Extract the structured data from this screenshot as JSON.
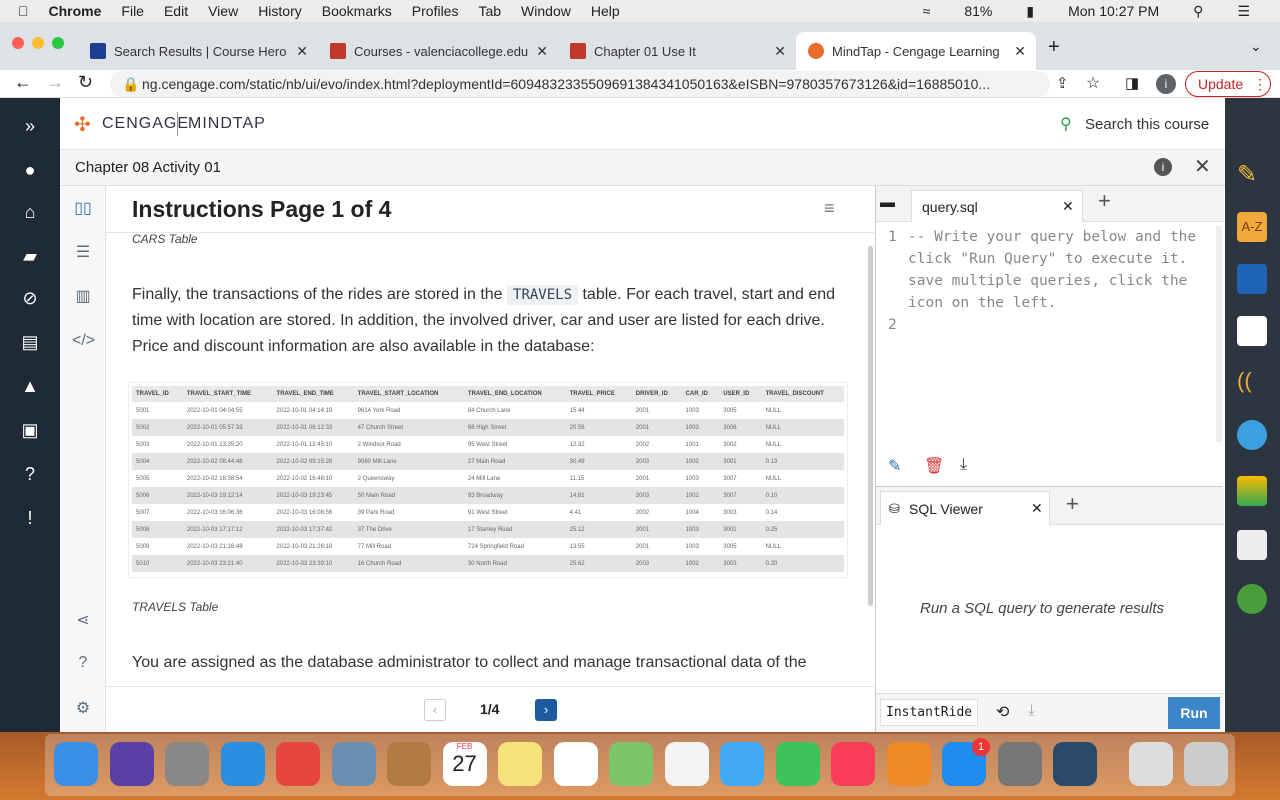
{
  "menubar": {
    "app": "Chrome",
    "items": [
      "File",
      "Edit",
      "View",
      "History",
      "Bookmarks",
      "Profiles",
      "Tab",
      "Window",
      "Help"
    ],
    "battery": "81%",
    "clock": "Mon 10:27 PM"
  },
  "tabs": [
    {
      "title": "Search Results | Course Hero",
      "color": "#1d3f91"
    },
    {
      "title": "Courses - valenciacollege.edu",
      "color": "#c0392b"
    },
    {
      "title": "Chapter 01 Use It",
      "color": "#c0392b"
    },
    {
      "title": "MindTap - Cengage Learning",
      "color": "#e86c2b",
      "active": true
    }
  ],
  "address": {
    "url": "ng.cengage.com/static/nb/ui/evo/index.html?deploymentId=6094832335509691384341050163&eISBN=9780357673126&id=16885010...",
    "update": "Update"
  },
  "header": {
    "brand": "CENGAGE",
    "product": "MINDTAP",
    "search": "Search this course"
  },
  "chapter": {
    "title": "Chapter 08 Activity 01"
  },
  "instructions": {
    "title": "Instructions Page 1 of 4",
    "cars_caption": "CARS Table",
    "para_before": "Finally, the transactions of the rides are stored in the",
    "table_name": "TRAVELS",
    "para_after": "table. For each travel, start and end time with location are stored. In addition, the involved driver, car and user are listed for each drive. Price and discount information are also available in the database:",
    "travels_caption": "TRAVELS Table",
    "para2": "You are assigned as the database administrator to collect and manage transactional data of the"
  },
  "travels": {
    "columns": [
      "TRAVEL_ID",
      "TRAVEL_START_TIME",
      "TRAVEL_END_TIME",
      "TRAVEL_START_LOCATION",
      "TRAVEL_END_LOCATION",
      "TRAVEL_PRICE",
      "DRIVER_ID",
      "CAR_ID",
      "USER_ID",
      "TRAVEL_DISCOUNT"
    ],
    "rows": [
      [
        "5001",
        "2022-10-01 04:04:55",
        "2022-10-01 04:14:19",
        "9614 York Road",
        "84 Church Lane",
        "15.44",
        "2001",
        "1003",
        "3005",
        "NULL"
      ],
      [
        "5002",
        "2022-10-01 05:57:33",
        "2022-10-01 06:12:33",
        "47 Church Street",
        "68 High Street",
        "20.56",
        "2001",
        "1003",
        "3006",
        "NULL"
      ],
      [
        "5003",
        "2022-10-01 13:35:20",
        "2022-10-01 13:45:10",
        "2 Windsor Road",
        "95 West Street",
        "12.32",
        "2002",
        "1001",
        "3002",
        "NULL"
      ],
      [
        "5004",
        "2022-10-02 08:44:48",
        "2022-10-02 09:15:28",
        "9060 Mill Lane",
        "27 Main Road",
        "30.49",
        "2003",
        "1002",
        "3001",
        "0.13"
      ],
      [
        "5005",
        "2022-10-02 16:38:54",
        "2022-10-02 16:48:10",
        "2 Queensway",
        "24 Mill Lane",
        "11.15",
        "2001",
        "1003",
        "3007",
        "NULL"
      ],
      [
        "5006",
        "2022-10-03 19:12:14",
        "2022-10-03 19:23:45",
        "50 Main Road",
        "93 Broadway",
        "14.61",
        "2003",
        "1002",
        "3007",
        "0.10"
      ],
      [
        "5007",
        "2022-10-03 16:06:36",
        "2022-10-03 16:08:56",
        "39 Park Road",
        "91 West Street",
        "4.41",
        "2002",
        "1004",
        "3003",
        "0.14"
      ],
      [
        "5008",
        "2022-10-03 17:17:12",
        "2022-10-03 17:37:42",
        "37 The Drive",
        "17 Stanley Road",
        "25.12",
        "2001",
        "1003",
        "3001",
        "0.25"
      ],
      [
        "5009",
        "2022-10-03 21:16:48",
        "2022-10-03 21:26:18",
        "77 Mill Road",
        "724 Springfield Road",
        "13.55",
        "2001",
        "1003",
        "3005",
        "NULL"
      ],
      [
        "5010",
        "2022-10-03 23:21:40",
        "2022-10-03 23:39:10",
        "16 Church Road",
        "30 North Road",
        "25.62",
        "2003",
        "1002",
        "3003",
        "0.20"
      ]
    ]
  },
  "pager": {
    "label": "1/4"
  },
  "editor": {
    "tab": "query.sql",
    "lines": [
      "-- Write your query below and the",
      "click \"Run Query\" to execute it.",
      "save multiple queries, click the",
      "icon on the left."
    ],
    "line_numbers": [
      "1",
      "2"
    ]
  },
  "viewer": {
    "tab": "SQL Viewer",
    "placeholder": "Run a SQL query to generate results",
    "instant": "InstantRide",
    "run": "Run"
  },
  "dock": {
    "calendar_month": "FEB",
    "calendar_day": "27",
    "appstore_badge": "1"
  }
}
